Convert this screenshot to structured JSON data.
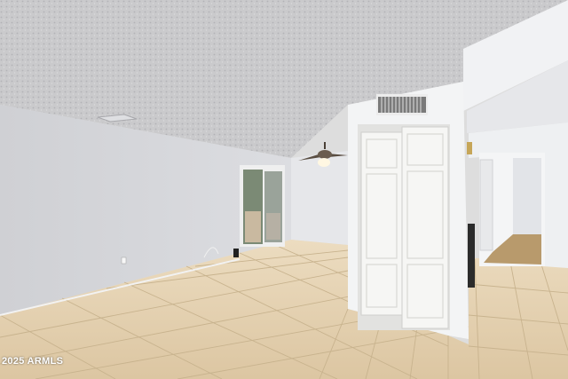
{
  "watermark": "2025 ARMLS",
  "colors": {
    "ceiling": "#c9c9cb",
    "wall_left": "#d6d7db",
    "wall_back": "#e4e5e8",
    "wall_right": "#eceef0",
    "floor": "#e3cfae",
    "grout": "#c9b48f",
    "door_white": "#f4f4f2",
    "vent": "#8a8a8a"
  },
  "icons": [
    "ceiling-fan-icon",
    "air-vent-icon",
    "closet-door-icon",
    "sliding-glass-door-icon",
    "outlet-icon"
  ]
}
